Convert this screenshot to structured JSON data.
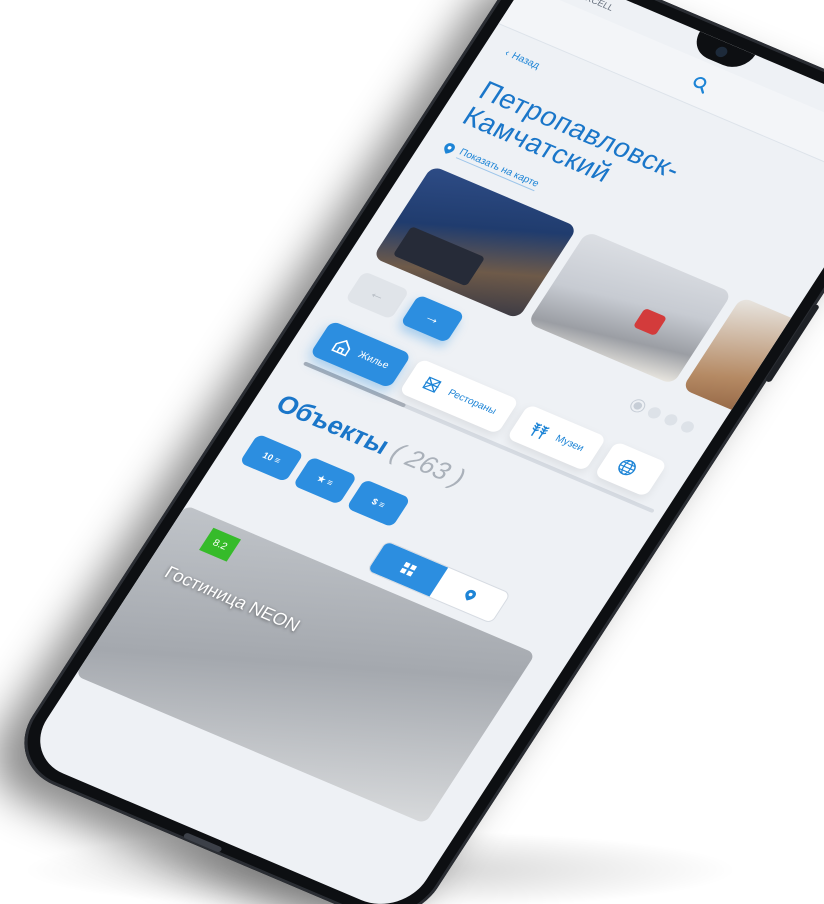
{
  "status": {
    "operator": "TURKCELL"
  },
  "nav": {
    "back_label": "Назад"
  },
  "city": {
    "title": "Петропавловск-Камчатский",
    "map_link": "Показать на карте"
  },
  "gallery": {
    "prev_glyph": "←",
    "next_glyph": "→"
  },
  "categories": [
    {
      "label": "Жилье",
      "icon": "house-icon",
      "active": true
    },
    {
      "label": "Рестораны",
      "icon": "restaurant-icon",
      "active": false
    },
    {
      "label": "Музеи",
      "icon": "wheat-icon",
      "active": false
    },
    {
      "label": "",
      "icon": "globe-icon",
      "active": false
    }
  ],
  "objects": {
    "heading": "Объекты",
    "count": "( 263 )"
  },
  "filters": [
    {
      "label": "10",
      "icon": "sort-rating-icon"
    },
    {
      "label": "★",
      "icon": "sort-stars-icon"
    },
    {
      "label": "$",
      "icon": "sort-price-icon"
    }
  ],
  "listing": {
    "rating": "8.2",
    "name": "Гостиница NEON"
  },
  "colors": {
    "accent": "#2c8ee0",
    "title": "#1a76c9",
    "rating": "#36bb2a",
    "background": "#eef1f5"
  }
}
